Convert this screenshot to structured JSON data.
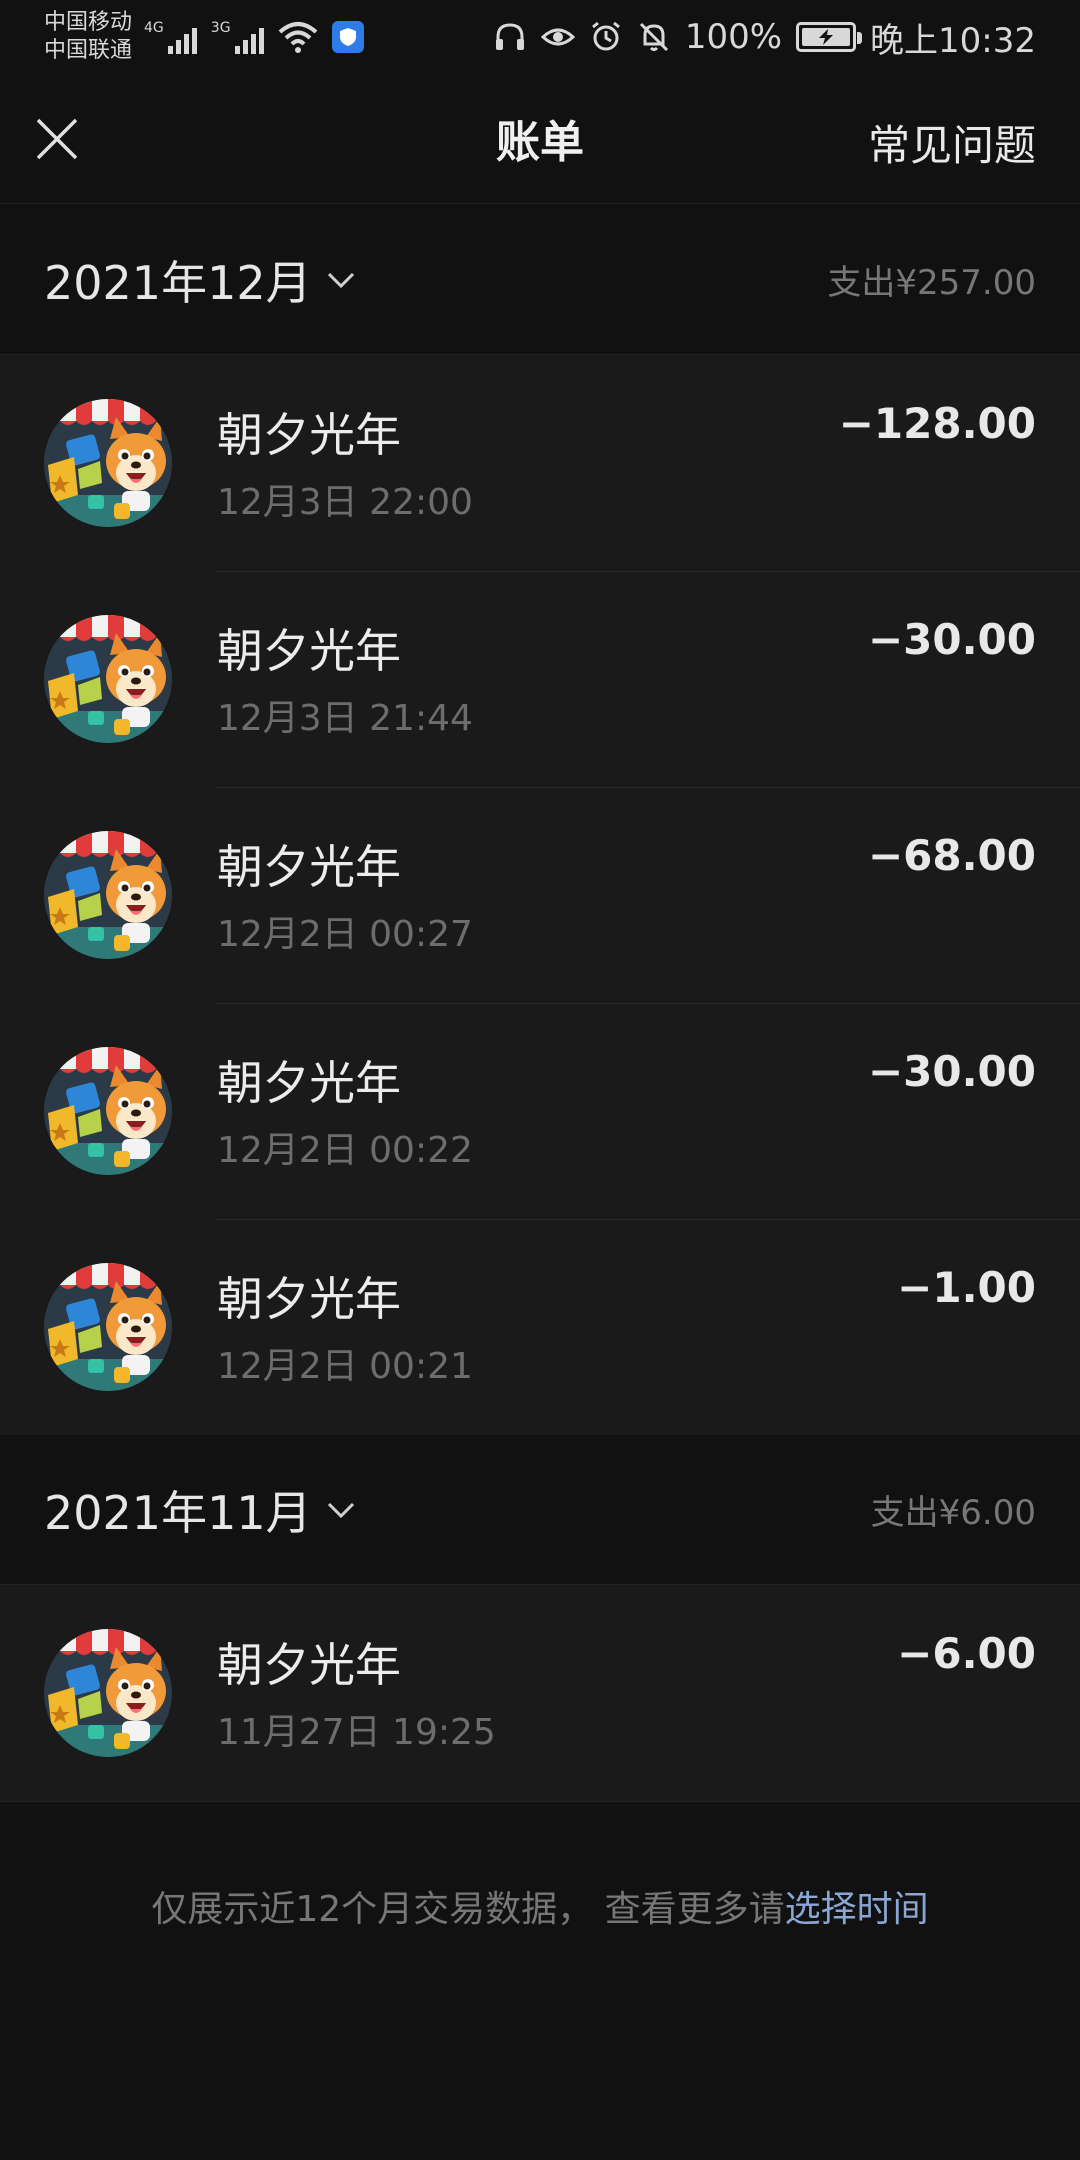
{
  "status_bar": {
    "carrier_1": "中国移动",
    "carrier_2": "中国联通",
    "net_1": "4G",
    "net_2": "3G",
    "battery": "100%",
    "battery_level": 1.0,
    "time": "晚上10:32"
  },
  "header": {
    "title": "账单",
    "faq_label": "常见问题",
    "close_icon": "close-icon"
  },
  "months": [
    {
      "label": "2021年12月",
      "spend": "支出¥257.00",
      "transactions": [
        {
          "name": "朝夕光年",
          "time": "12月3日 22:00",
          "amount": "−128.00"
        },
        {
          "name": "朝夕光年",
          "time": "12月3日 21:44",
          "amount": "−30.00"
        },
        {
          "name": "朝夕光年",
          "time": "12月2日 00:27",
          "amount": "−68.00"
        },
        {
          "name": "朝夕光年",
          "time": "12月2日 00:22",
          "amount": "−30.00"
        },
        {
          "name": "朝夕光年",
          "time": "12月2日 00:21",
          "amount": "−1.00"
        }
      ]
    },
    {
      "label": "2021年11月",
      "spend": "支出¥6.00",
      "transactions": [
        {
          "name": "朝夕光年",
          "time": "11月27日 19:25",
          "amount": "−6.00"
        }
      ]
    }
  ],
  "footer": {
    "note": "仅展示近12个月交易数据， 查看更多请",
    "link": "选择时间"
  },
  "colors": {
    "background": "#111111",
    "row_background": "#1a1a1a",
    "link": "#8aa6d4",
    "muted": "#777777"
  }
}
